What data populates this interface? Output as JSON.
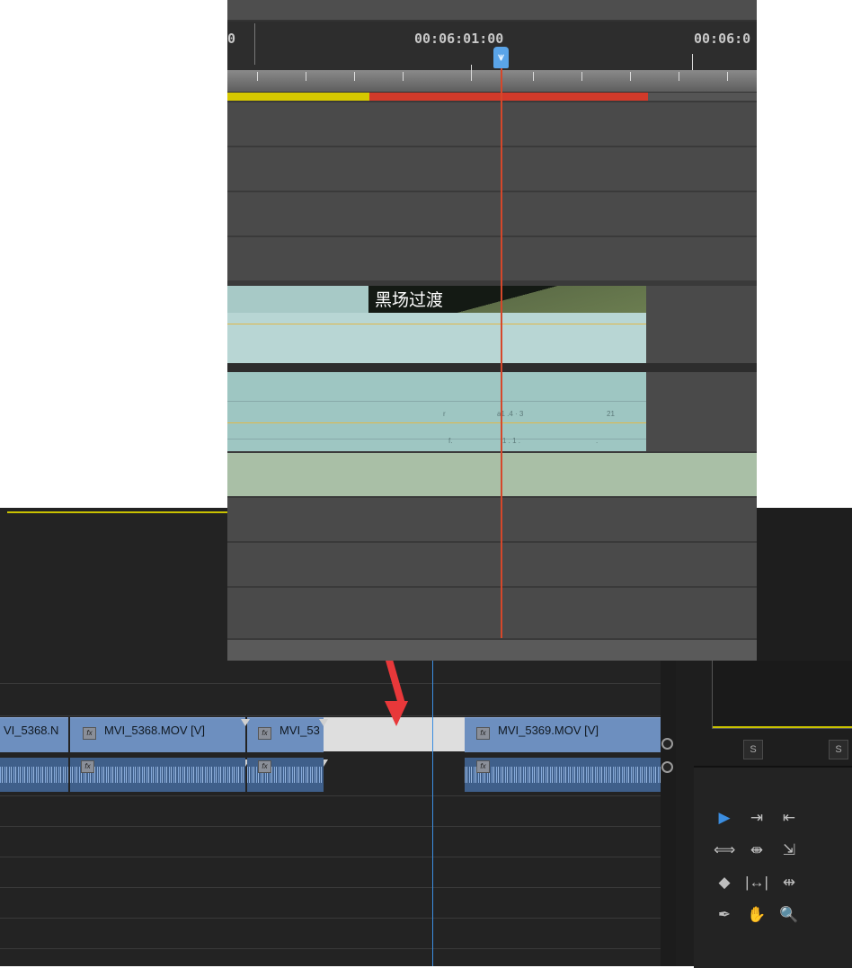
{
  "zoomed_view": {
    "timecodes": [
      "0",
      "00:06:01:00",
      "00:06:0"
    ],
    "transition_label": "黑场过渡",
    "audio_glyphs": [
      "r",
      "a1 .4 · 3",
      "21",
      "f.",
      "1 . 1 .",
      "."
    ],
    "colors": {
      "render_yellow": "#d6c800",
      "render_red": "#d23a2a",
      "playhead": "#d6472a",
      "clip_teal": "#b8d6d4",
      "audio_teal": "#9ec6c2",
      "audio_track": "#a9bfa6"
    }
  },
  "timeline": {
    "clips": {
      "v1_partial_label": "VI_5368.N",
      "v2_label": "MVI_5368.MOV [V]",
      "v3_label": "MVI_53",
      "v4_label": "MVI_5369.MOV [V]",
      "fx_badge": "fx"
    },
    "colors": {
      "clip_video": "#6d8fbf",
      "clip_audio": "#3f5f8a",
      "gap": "#dedede",
      "annotation_arrow": "#e8383a",
      "playhead": "#3b8de0"
    }
  },
  "right_panel": {
    "solo_buttons": [
      "S",
      "S"
    ]
  },
  "tools": [
    {
      "icon": "selection-tool-icon",
      "glyph": "▶"
    },
    {
      "icon": "track-select-forward-icon",
      "glyph": "⇥"
    },
    {
      "icon": "track-select-backward-icon",
      "glyph": "⇤"
    },
    {
      "icon": "ripple-edit-icon",
      "glyph": "⟺"
    },
    {
      "icon": "rolling-edit-icon",
      "glyph": "⇼"
    },
    {
      "icon": "rate-stretch-icon",
      "glyph": "⇲"
    },
    {
      "icon": "razor-icon",
      "glyph": "◆"
    },
    {
      "icon": "slip-icon",
      "glyph": "|↔|"
    },
    {
      "icon": "slide-icon",
      "glyph": "⇹"
    },
    {
      "icon": "pen-icon",
      "glyph": "✒"
    },
    {
      "icon": "hand-icon",
      "glyph": "✋"
    },
    {
      "icon": "zoom-icon",
      "glyph": "🔍"
    }
  ]
}
